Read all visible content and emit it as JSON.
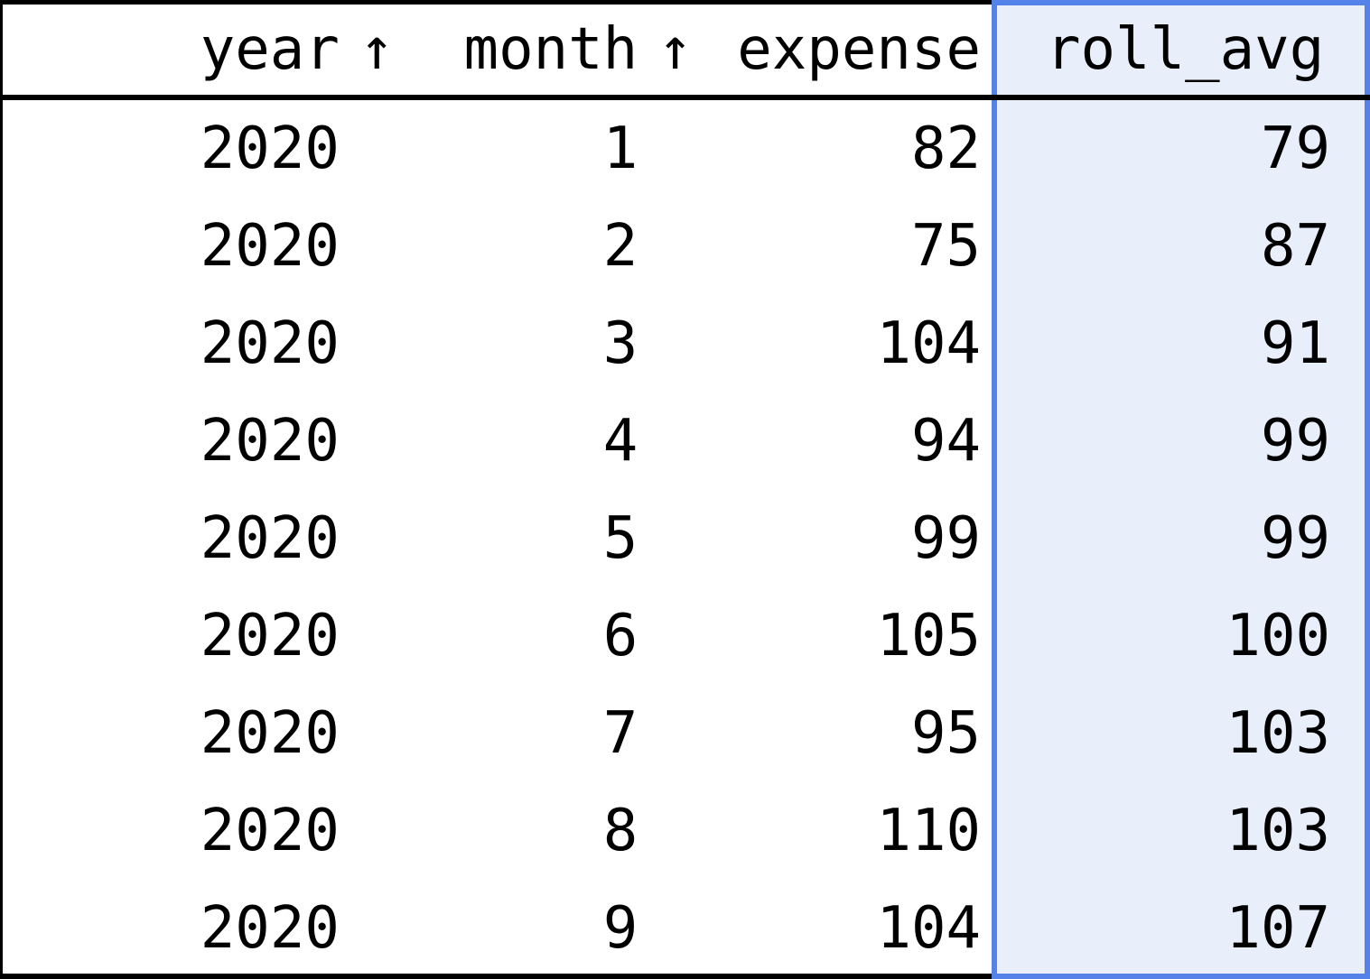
{
  "table": {
    "columns": [
      {
        "key": "year",
        "label": "year",
        "sort_indicator": "↑",
        "align": "right",
        "highlighted": false
      },
      {
        "key": "month",
        "label": "month",
        "sort_indicator": "↑",
        "align": "right",
        "highlighted": false
      },
      {
        "key": "expense",
        "label": "expense",
        "sort_indicator": "",
        "align": "right",
        "highlighted": false
      },
      {
        "key": "roll_avg",
        "label": "roll_avg",
        "sort_indicator": "",
        "align": "right",
        "highlighted": true
      }
    ],
    "rows": [
      {
        "year": "2020",
        "month": "1",
        "expense": "82",
        "roll_avg": "79"
      },
      {
        "year": "2020",
        "month": "2",
        "expense": "75",
        "roll_avg": "87"
      },
      {
        "year": "2020",
        "month": "3",
        "expense": "104",
        "roll_avg": "91"
      },
      {
        "year": "2020",
        "month": "4",
        "expense": "94",
        "roll_avg": "99"
      },
      {
        "year": "2020",
        "month": "5",
        "expense": "99",
        "roll_avg": "99"
      },
      {
        "year": "2020",
        "month": "6",
        "expense": "105",
        "roll_avg": "100"
      },
      {
        "year": "2020",
        "month": "7",
        "expense": "95",
        "roll_avg": "103"
      },
      {
        "year": "2020",
        "month": "8",
        "expense": "110",
        "roll_avg": "103"
      },
      {
        "year": "2020",
        "month": "9",
        "expense": "104",
        "roll_avg": "107"
      }
    ],
    "highlight": {
      "column_key": "roll_avg",
      "fill_color": "#e8effb",
      "border_color": "#5582e8"
    },
    "style": {
      "text_color": "#000000",
      "background_color": "#ffffff",
      "rule_color": "#000000"
    },
    "row_count": 9
  }
}
